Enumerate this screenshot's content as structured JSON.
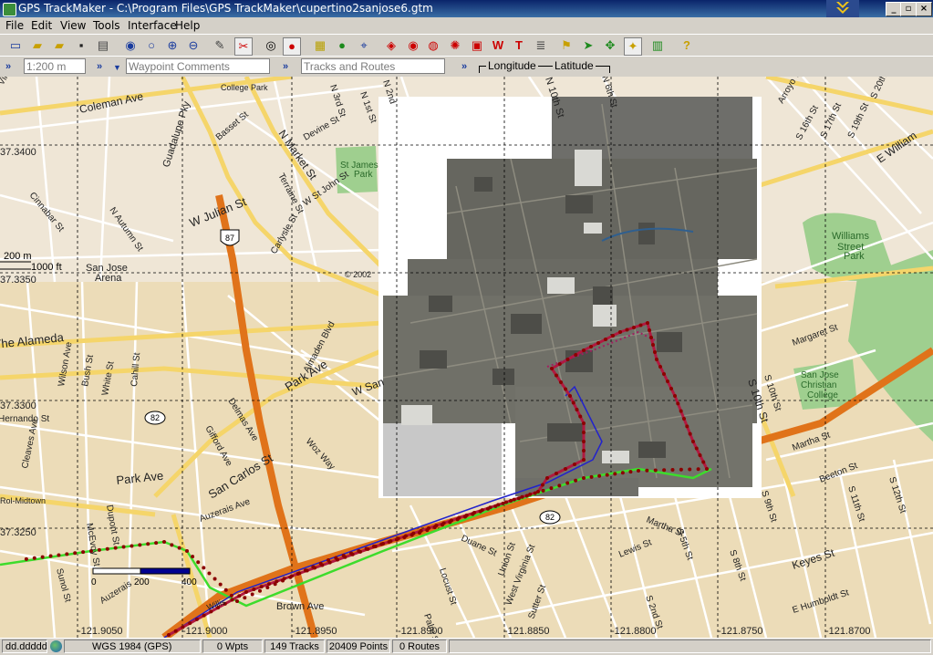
{
  "window": {
    "title": "GPS TrackMaker - C:\\Program Files\\GPS TrackMaker\\cupertino2sanjose6.gtm",
    "min": "_",
    "max": "▫",
    "close": "×"
  },
  "menu": [
    "File",
    "Edit",
    "View",
    "Tools",
    "Interface",
    "Help"
  ],
  "toolbar_icons": [
    "new-file-icon",
    "open-folder-icon",
    "open-icon",
    "save-icon",
    "print-icon",
    "zoom-globe-icon",
    "magnifier-icon",
    "zoom-in-icon",
    "zoom-out-icon",
    "pencil-icon",
    "route-edit-icon",
    "eye-icon",
    "layers-icon",
    "ruler-icon",
    "globe-icon",
    "waypoint-icon",
    "track-icon",
    "gps-icon",
    "find-icon",
    "network-icon",
    "waypoint-w-icon",
    "text-t-icon",
    "list-icon",
    "hand-icon",
    "flag-icon",
    "select-arrow-icon",
    "star-icon",
    "book-icon",
    "help-icon"
  ],
  "addressbar": {
    "scale": "1:200 m",
    "waypoint_comments": "Waypoint Comments",
    "tracks_routes": "Tracks and Routes",
    "longitude": "Longitude",
    "latitude": "Latitude"
  },
  "map": {
    "streets": [
      {
        "text": "Coleman Ave"
      },
      {
        "text": "Guadalupe Pky"
      },
      {
        "text": "College Park"
      },
      {
        "text": "Basset St"
      },
      {
        "text": "Devine St"
      },
      {
        "text": "N Market St"
      },
      {
        "text": "N 1st St"
      },
      {
        "text": "W St John St"
      },
      {
        "text": "Terraine St"
      },
      {
        "text": "W Julian St"
      },
      {
        "text": "N Autumn St"
      },
      {
        "text": "Cinnabar St"
      },
      {
        "text": "Carlysle St"
      },
      {
        "text": "San Jose"
      },
      {
        "text": "Arena"
      },
      {
        "text": "The Alameda"
      },
      {
        "text": "Wilson Ave"
      },
      {
        "text": "Bush St"
      },
      {
        "text": "White St"
      },
      {
        "text": "Cahill St"
      },
      {
        "text": "Hernando St"
      },
      {
        "text": "Cleaves Ave"
      },
      {
        "text": "Delmas Ave"
      },
      {
        "text": "Gifford Ave"
      },
      {
        "text": "Almaden Blvd"
      },
      {
        "text": "Park Ave"
      },
      {
        "text": "W San"
      },
      {
        "text": "San Carlos St"
      },
      {
        "text": "Woz Way"
      },
      {
        "text": "Park Ave"
      },
      {
        "text": "McEvoy St"
      },
      {
        "text": "Dupont St"
      },
      {
        "text": "Auzerais Ave"
      },
      {
        "text": "Sunol St"
      },
      {
        "text": "Auzerais"
      },
      {
        "text": "Willis"
      },
      {
        "text": "Brown Ave"
      },
      {
        "text": "Duane St"
      },
      {
        "text": "Locust St"
      },
      {
        "text": "Union St"
      },
      {
        "text": "West Virginia St"
      },
      {
        "text": "Sutter St"
      },
      {
        "text": "Palm St"
      },
      {
        "text": "Martha St"
      },
      {
        "text": "S 5th St"
      },
      {
        "text": "Lewis St"
      },
      {
        "text": "S 2nd St"
      },
      {
        "text": "S 8th St"
      },
      {
        "text": "Keyes St"
      },
      {
        "text": "E Humboldt St"
      },
      {
        "text": "S 10th St"
      },
      {
        "text": "S 11th St"
      },
      {
        "text": "S 12th St"
      },
      {
        "text": "Beeton St"
      },
      {
        "text": "S 9th St"
      },
      {
        "text": "Martha St"
      },
      {
        "text": "Margaret St"
      },
      {
        "text": "S 10th St"
      },
      {
        "text": "E William"
      },
      {
        "text": "S 20th St"
      },
      {
        "text": "S 19th St"
      },
      {
        "text": "S 17th St"
      },
      {
        "text": "Arroyo Way"
      },
      {
        "text": "S 16th St"
      },
      {
        "text": "St James"
      },
      {
        "text": "Park"
      },
      {
        "text": "Williams"
      },
      {
        "text": "Street"
      },
      {
        "text": "Park"
      },
      {
        "text": "San Jose"
      },
      {
        "text": "Christian"
      },
      {
        "text": "College"
      },
      {
        "text": "N 3rd St"
      },
      {
        "text": "N 10th St"
      },
      {
        "text": "N 6th St"
      },
      {
        "text": "N 2nd"
      },
      {
        "text": "Rol-Midtown"
      },
      {
        "text": "Vine St"
      },
      {
        "text": "© 2002"
      }
    ],
    "lat_labels": [
      "37.3400",
      "37.3350",
      "37.3300",
      "37.3250"
    ],
    "lon_labels": [
      "-121.9050",
      "-121.9000",
      "-121.8950",
      "-121.8900",
      "-121.8850",
      "-121.8800",
      "-121.8750",
      "-121.8700"
    ],
    "shields": [
      "87",
      "82",
      "82"
    ],
    "scale_topleft": {
      "m": "200 m",
      "ft": "1000 ft"
    },
    "scale_bar": {
      "v0": "0",
      "v1": "200",
      "v2": "400"
    }
  },
  "status": {
    "format": "dd.ddddd",
    "datum": "WGS 1984 (GPS)",
    "wpts": "0 Wpts",
    "tracks": "149 Tracks",
    "points": "20409 Points",
    "routes": "0 Routes"
  }
}
